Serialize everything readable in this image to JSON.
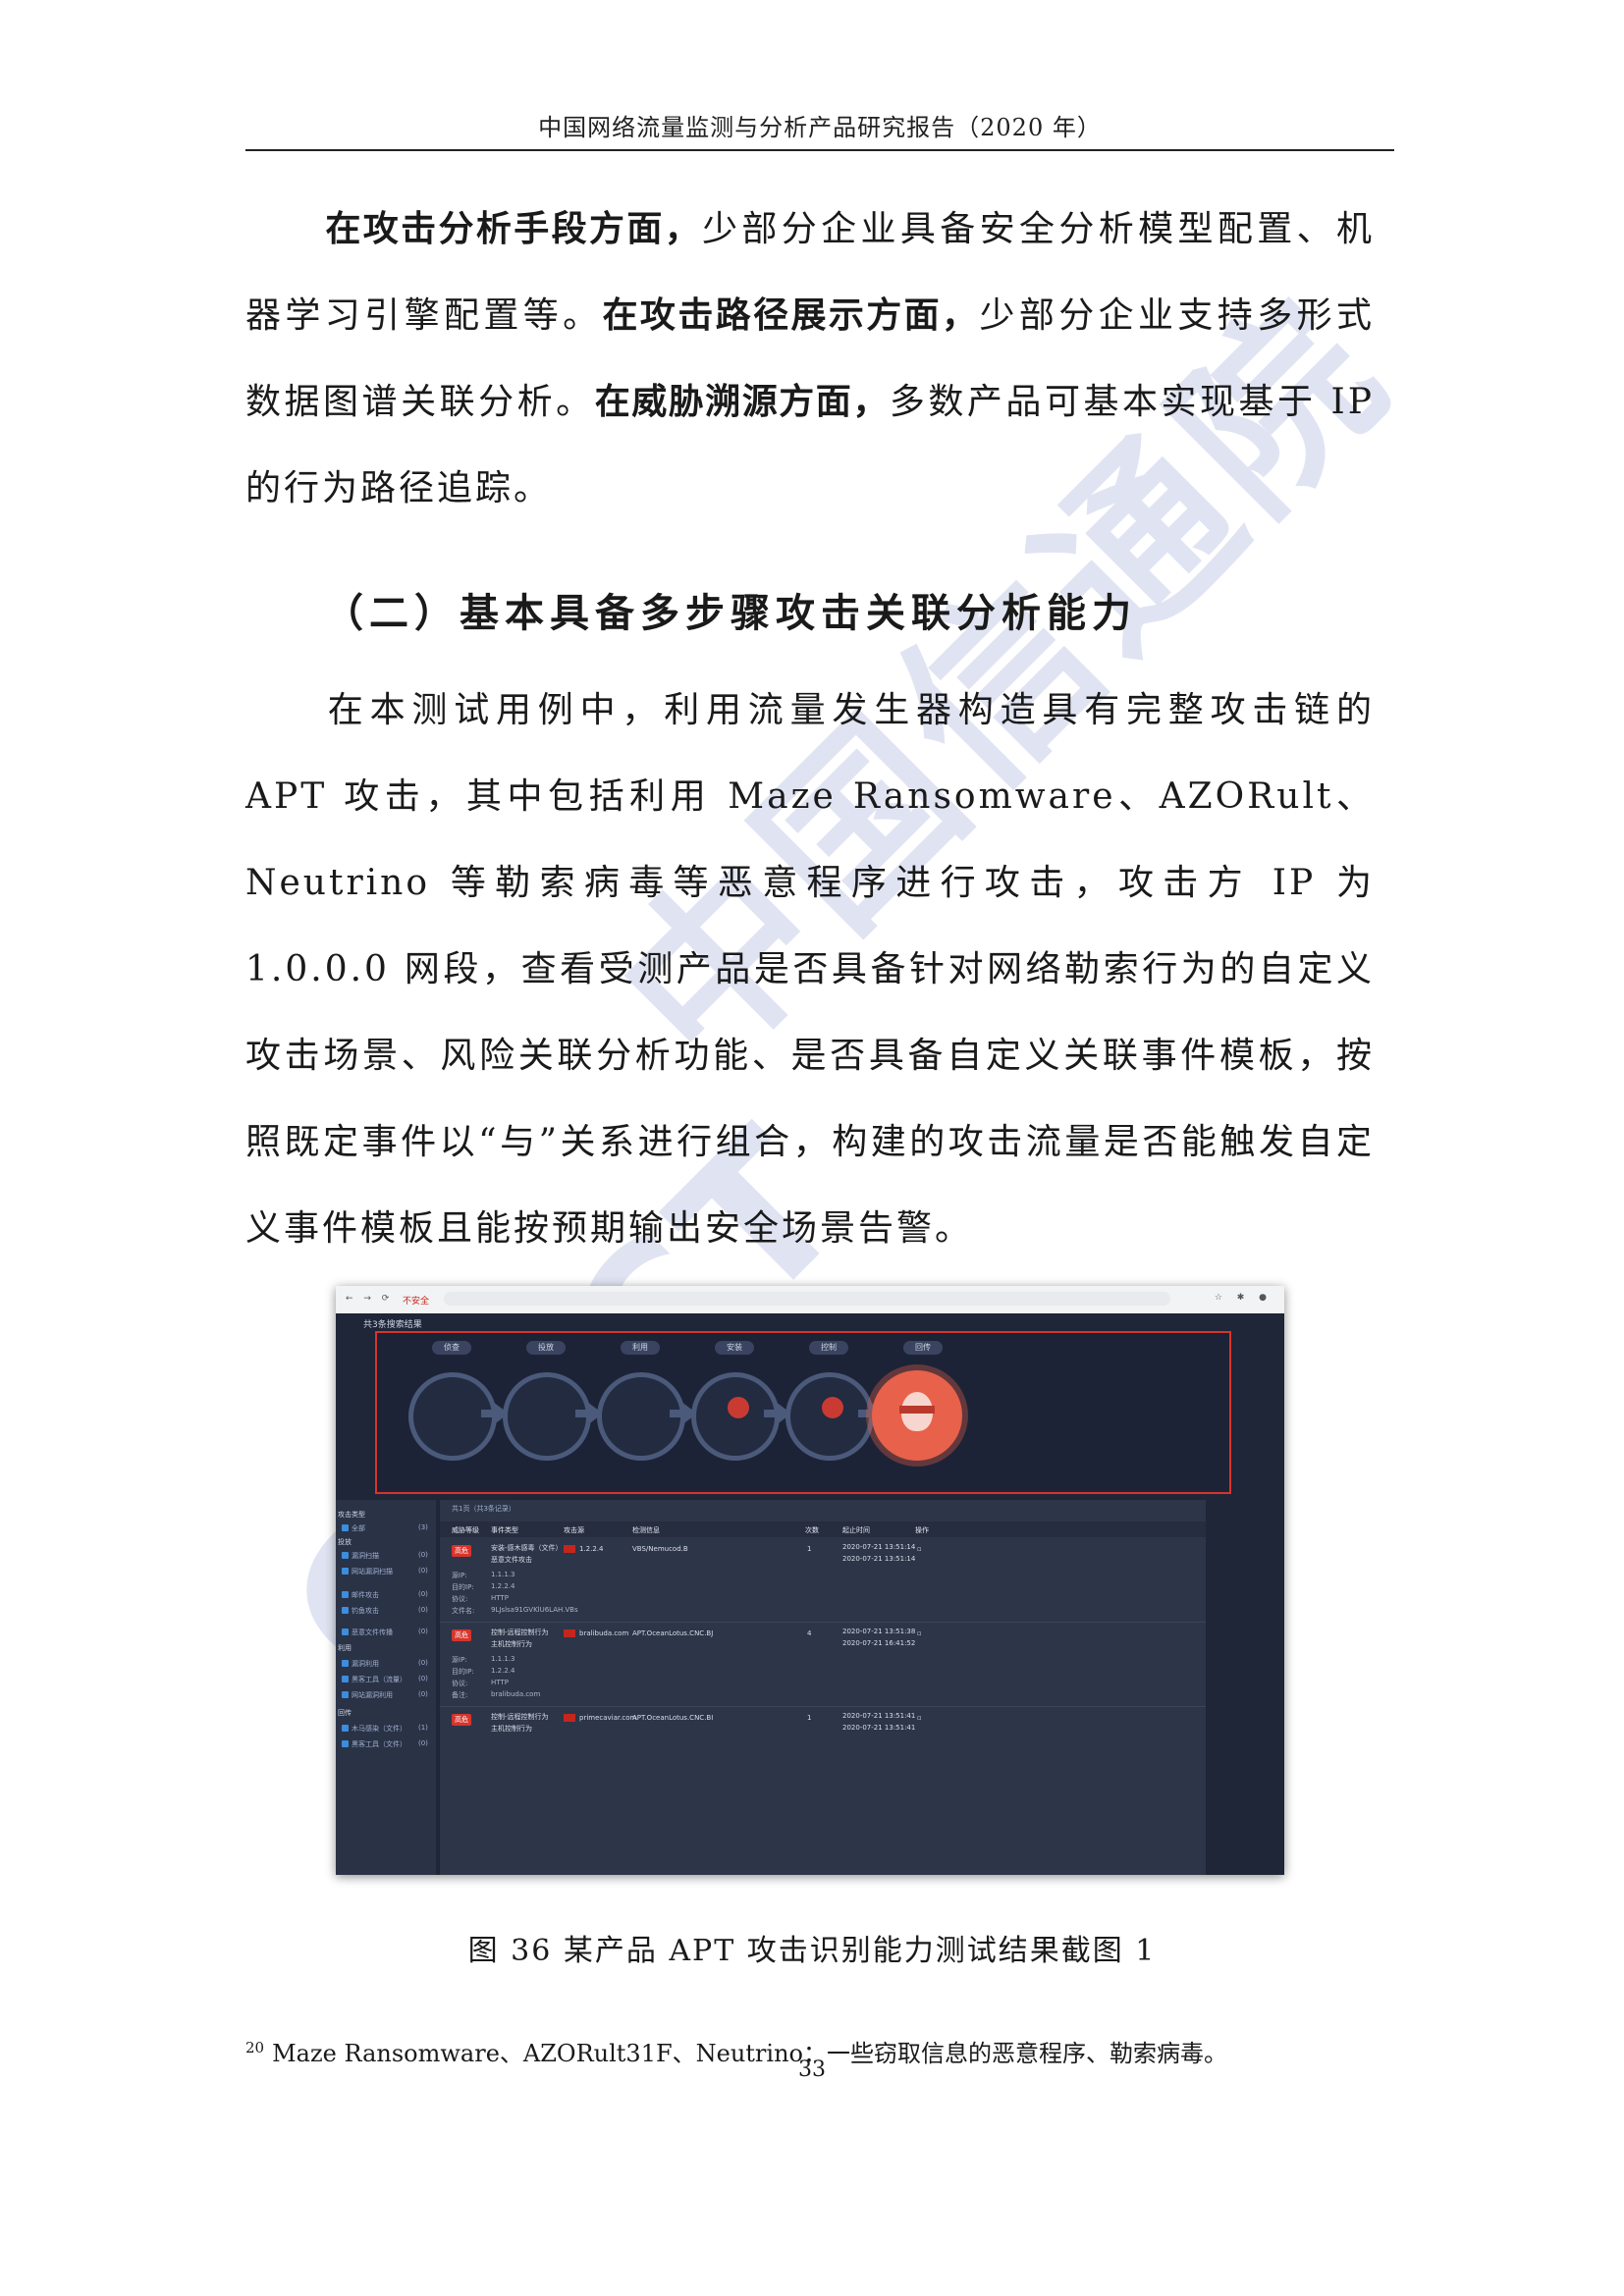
{
  "header": {
    "title": "中国网络流量监测与分析产品研究报告（2020 年）"
  },
  "paragraph1": {
    "lead1": "在攻击分析手段方面，",
    "text1": "少部分企业具备安全分析模型配置、机器学习引擎配置等。",
    "lead2": "在攻击路径展示方面，",
    "text2": "少部分企业支持多形式数据图谱关联分析。",
    "lead3": "在威胁溯源方面，",
    "text3": "多数产品可基本实现基于 IP 的行为路径追踪。"
  },
  "section": {
    "heading": "（二）基本具备多步骤攻击关联分析能力"
  },
  "paragraph2": {
    "text": "在本测试用例中，利用流量发生器构造具有完整攻击链的 APT 攻击，其中包括利用 Maze Ransomware、AZORult、Neutrino 等勒索病毒等恶意程序进行攻击，攻击方 IP 为 1.0.0.0 网段，查看受测产品是否具备针对网络勒索行为的自定义攻击场景、风险关联分析功能、是否具备自定义关联事件模板，按照既定事件以“与”关系进行组合，构建的攻击流量是否能触发自定义事件模板且能按预期输出安全场景告警。"
  },
  "watermark": {
    "cn": "中国信通院",
    "en": "CAICT"
  },
  "screenshot": {
    "browser": {
      "insecure_label": "不安全"
    },
    "result_label": "共3条搜索结果",
    "stages": [
      {
        "label": "侦查",
        "active": false
      },
      {
        "label": "投放",
        "active": false
      },
      {
        "label": "利用",
        "active": false
      },
      {
        "label": "安装",
        "active": true
      },
      {
        "label": "控制",
        "active": true
      },
      {
        "label": "回传",
        "active": true
      }
    ],
    "sidebar": {
      "groups": [
        "攻击类型",
        "投放",
        "利用",
        "回传",
        "攻击"
      ],
      "items": [
        {
          "label": "全部",
          "count": "(3)"
        },
        {
          "label": "漏洞扫描",
          "count": "(0)"
        },
        {
          "label": "网站漏洞扫描",
          "count": "(0)"
        },
        {
          "label": "邮件攻击",
          "count": "(0)"
        },
        {
          "label": "钓鱼攻击",
          "count": "(0)"
        },
        {
          "label": "恶意文件传播",
          "count": "(0)"
        },
        {
          "label": "漏洞利用",
          "count": "(0)"
        },
        {
          "label": "黑客工具（流量）",
          "count": "(0)"
        },
        {
          "label": "网站漏洞利用",
          "count": "(0)"
        },
        {
          "label": "木马感染（文件）",
          "count": "(1)"
        },
        {
          "label": "黑客工具（文件）",
          "count": "(0)"
        }
      ]
    },
    "table": {
      "summary": "共1页（共3条记录）",
      "headers": [
        "威胁等级",
        "事件类型",
        "攻击源",
        "检测信息",
        "次数",
        "起止时间",
        "操作"
      ],
      "rows": [
        {
          "level": "高危",
          "event": [
            "安装-感木感毒（文件）",
            "恶意文件攻击"
          ],
          "source": "1.2.2.4",
          "detect": "VBS/Nemucod.B",
          "count": "1",
          "time": [
            "2020-07-21 13:51:14",
            "2020-07-21 13:51:14"
          ],
          "details": [
            [
              "源IP:",
              "1.1.1.3"
            ],
            [
              "目的IP:",
              "1.2.2.4"
            ],
            [
              "协议:",
              "HTTP"
            ],
            [
              "文件名:",
              "9LJslsa91GVKlU6LAH.VBs"
            ]
          ]
        },
        {
          "level": "高危",
          "event": [
            "控制-远程控制行为",
            "主机控制行为"
          ],
          "source": "bralibuda.com",
          "detect": "APT.OceanLotus.CNC.BJ",
          "count": "4",
          "time": [
            "2020-07-21 13:51:38",
            "2020-07-21 16:41:52"
          ],
          "details": [
            [
              "源IP:",
              "1.1.1.3"
            ],
            [
              "目的IP:",
              "1.2.2.4"
            ],
            [
              "协议:",
              "HTTP"
            ],
            [
              "备注:",
              "bralibuda.com"
            ]
          ]
        },
        {
          "level": "高危",
          "event": [
            "控制-远程控制行为",
            "主机控制行为"
          ],
          "source": "primecaviar.com",
          "detect": "APT.OceanLotus.CNC.BI",
          "count": "1",
          "time": [
            "2020-07-21 13:51:41",
            "2020-07-21 13:51:41"
          ],
          "details": []
        }
      ]
    }
  },
  "caption": "图 36 某产品 APT 攻击识别能力测试结果截图 1",
  "footnote": {
    "marker": "20",
    "text": "Maze Ransomware、AZORult31F、Neutrino：一些窃取信息的恶意程序、勒索病毒。"
  },
  "page_number": "33"
}
